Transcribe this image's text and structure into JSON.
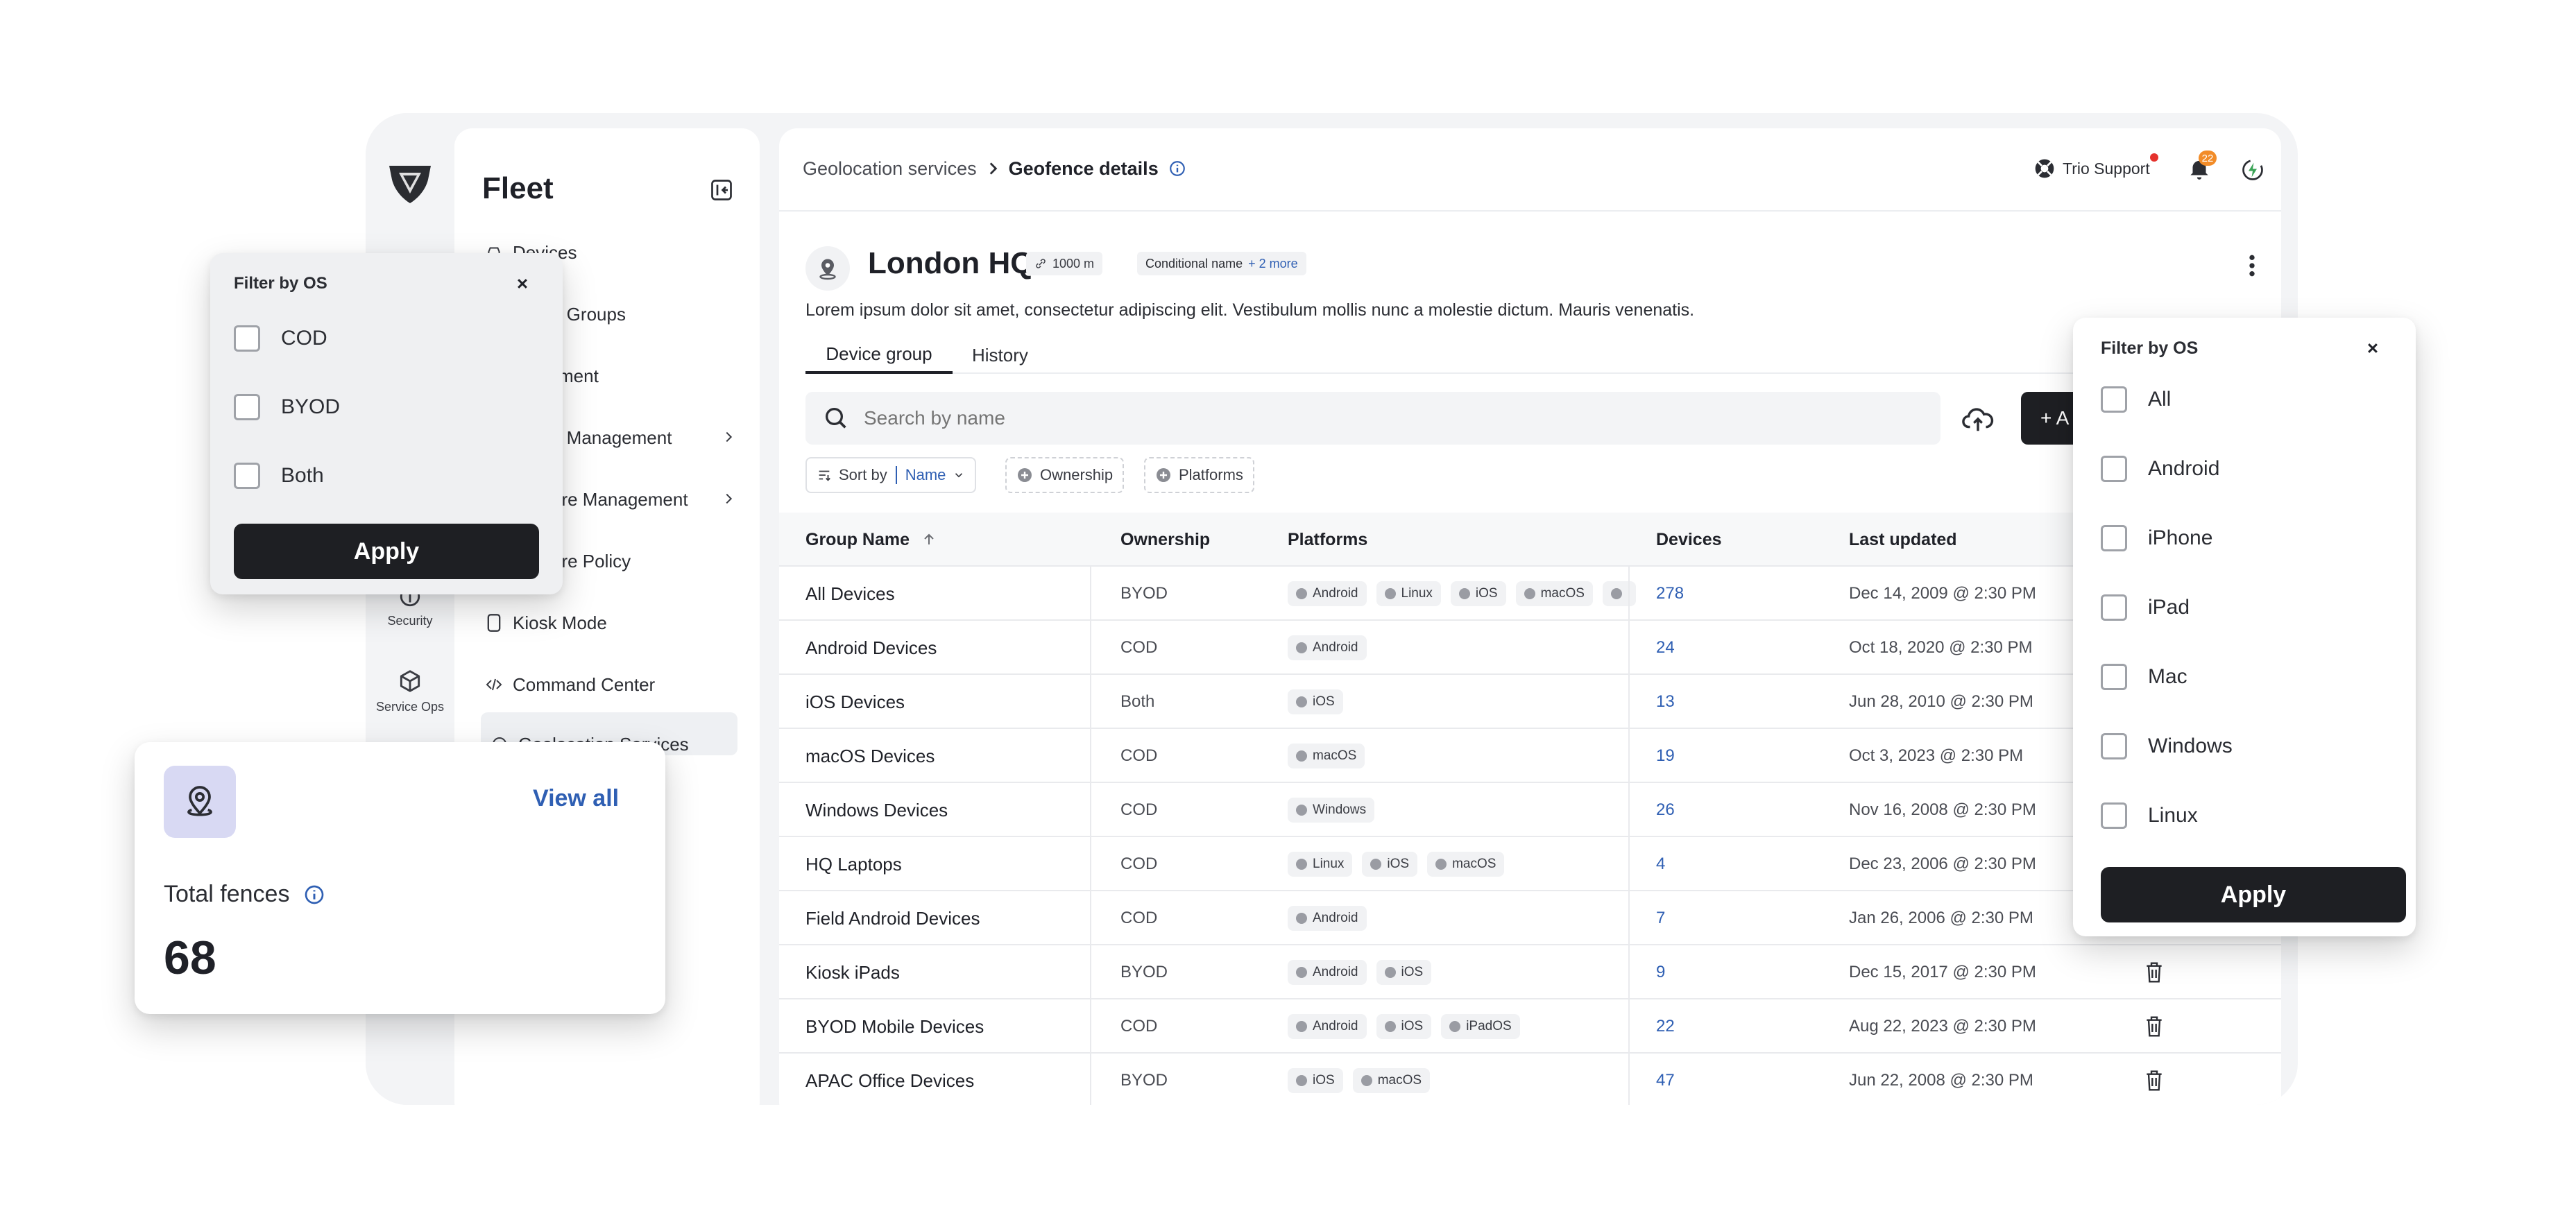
{
  "sidebar": {
    "title": "Fleet",
    "items": [
      {
        "label": "Devices",
        "icon": "car-icon"
      },
      {
        "label": "e Groups",
        "icon": ""
      },
      {
        "label": "ment",
        "icon": ""
      },
      {
        "label": "e Management",
        "icon": ""
      },
      {
        "label": "are Management",
        "icon": ""
      },
      {
        "label": "are Policy",
        "icon": ""
      },
      {
        "label": "Kiosk Mode",
        "icon": "kiosk-icon"
      },
      {
        "label": "Command Center",
        "icon": "code-icon"
      },
      {
        "label": "Geolocation Services",
        "icon": "location-icon"
      }
    ]
  },
  "rail": {
    "items": [
      {
        "label": "Security",
        "icon": "shield-icon"
      },
      {
        "label": "Service Ops",
        "icon": "box-icon"
      }
    ]
  },
  "header": {
    "breadcrumb_parent": "Geolocation services",
    "breadcrumb_current": "Geofence details",
    "support_label": "Trio Support",
    "notification_count": "22"
  },
  "geofence": {
    "title": "London HQ",
    "radius": "1000 m",
    "condition_label": "Conditional name",
    "more_label": "+ 2 more",
    "description": "Lorem ipsum dolor sit amet, consectetur adipiscing elit. Vestibulum mollis nunc a molestie dictum. Mauris venenatis."
  },
  "tabs": [
    {
      "label": "Device group",
      "active": true
    },
    {
      "label": "History",
      "active": false
    }
  ],
  "search": {
    "placeholder": "Search by name"
  },
  "add_button": {
    "label": "+ A"
  },
  "filters": {
    "sort_by_label": "Sort by",
    "sort_value": "Name",
    "ownership_label": "Ownership",
    "platforms_label": "Platforms"
  },
  "table": {
    "headers": [
      "Group Name",
      "Ownership",
      "Platforms",
      "Devices",
      "Last updated"
    ],
    "rows": [
      {
        "name": "All Devices",
        "ownership": "BYOD",
        "platforms": [
          "Android",
          "Linux",
          "iOS",
          "macOS",
          ""
        ],
        "devices": "278",
        "updated": "Dec 14, 2009 @ 2:30 PM"
      },
      {
        "name": "Android Devices",
        "ownership": "COD",
        "platforms": [
          "Android"
        ],
        "devices": "24",
        "updated": "Oct 18, 2020 @ 2:30 PM"
      },
      {
        "name": "iOS Devices",
        "ownership": "Both",
        "platforms": [
          "iOS"
        ],
        "devices": "13",
        "updated": "Jun 28, 2010 @ 2:30 PM"
      },
      {
        "name": "macOS Devices",
        "ownership": "COD",
        "platforms": [
          "macOS"
        ],
        "devices": "19",
        "updated": "Oct 3, 2023 @ 2:30 PM"
      },
      {
        "name": "Windows Devices",
        "ownership": "COD",
        "platforms": [
          "Windows"
        ],
        "devices": "26",
        "updated": "Nov 16, 2008 @ 2:30 PM"
      },
      {
        "name": "HQ Laptops",
        "ownership": "COD",
        "platforms": [
          "Linux",
          "iOS",
          "macOS"
        ],
        "devices": "4",
        "updated": "Dec 23, 2006 @ 2:30 PM"
      },
      {
        "name": "Field Android Devices",
        "ownership": "COD",
        "platforms": [
          "Android"
        ],
        "devices": "7",
        "updated": "Jan 26, 2006 @ 2:30 PM"
      },
      {
        "name": "Kiosk iPads",
        "ownership": "BYOD",
        "platforms": [
          "Android",
          "iOS"
        ],
        "devices": "9",
        "updated": "Dec 15, 2017 @ 2:30 PM"
      },
      {
        "name": "BYOD Mobile Devices",
        "ownership": "COD",
        "platforms": [
          "Android",
          "iOS",
          "iPadOS"
        ],
        "devices": "22",
        "updated": "Aug 22, 2023 @ 2:30 PM"
      },
      {
        "name": "APAC Office Devices",
        "ownership": "BYOD",
        "platforms": [
          "iOS",
          "macOS"
        ],
        "devices": "47",
        "updated": "Jun 22, 2008 @ 2:30 PM"
      }
    ]
  },
  "filter_left": {
    "title": "Filter by OS",
    "options": [
      "COD",
      "BYOD",
      "Both"
    ],
    "apply_label": "Apply"
  },
  "filter_right": {
    "title": "Filter by OS",
    "options": [
      "All",
      "Android",
      "iPhone",
      "iPad",
      "Mac",
      "Windows",
      "Linux"
    ],
    "apply_label": "Apply"
  },
  "fences_card": {
    "view_all_label": "View all",
    "label": "Total fences",
    "value": "68"
  },
  "colors": {
    "accent": "#2f5fb3",
    "dark_button": "#1e1f23",
    "card_icon_bg": "#d8d9f3",
    "notification": "#f28c28",
    "online": "#e5322d"
  }
}
